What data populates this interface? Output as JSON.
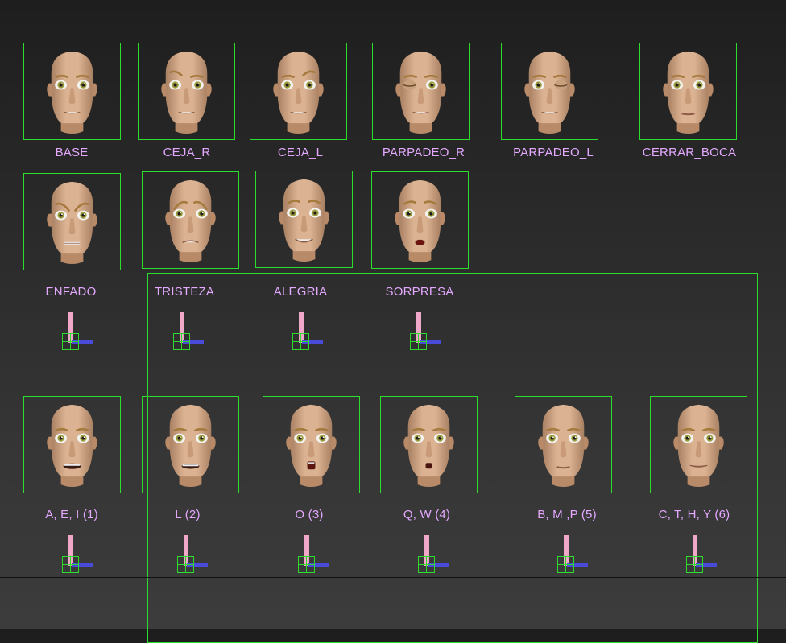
{
  "colors": {
    "frame": "#2edc2e",
    "label": "#e4a8ff",
    "slider": "#f0a8c8",
    "axis": "#4a4ad8",
    "skin": "#d9b08c"
  },
  "row1": [
    {
      "label": "BASE",
      "expr": "neutral"
    },
    {
      "label": "CEJA_R",
      "expr": "brow_r"
    },
    {
      "label": "CEJA_L",
      "expr": "brow_l"
    },
    {
      "label": "PARPADEO_R",
      "expr": "blink_r"
    },
    {
      "label": "PARPADEO_L",
      "expr": "blink_l"
    },
    {
      "label": "CERRAR_BOCA",
      "expr": "closed_mouth"
    }
  ],
  "row2": [
    {
      "label": "ENFADO",
      "expr": "angry"
    },
    {
      "label": "TRISTEZA",
      "expr": "sad"
    },
    {
      "label": "ALEGRIA",
      "expr": "happy"
    },
    {
      "label": "SORPRESA",
      "expr": "surprise"
    }
  ],
  "row3": [
    {
      "label": "A, E, I (1)",
      "expr": "open_wide"
    },
    {
      "label": "L (2)",
      "expr": "l_shape"
    },
    {
      "label": "O (3)",
      "expr": "o_shape"
    },
    {
      "label": "Q, W (4)",
      "expr": "q_shape"
    },
    {
      "label": "B, M ,P (5)",
      "expr": "closed_mouth"
    },
    {
      "label": "C, T, H, Y (6)",
      "expr": "teeth"
    }
  ]
}
